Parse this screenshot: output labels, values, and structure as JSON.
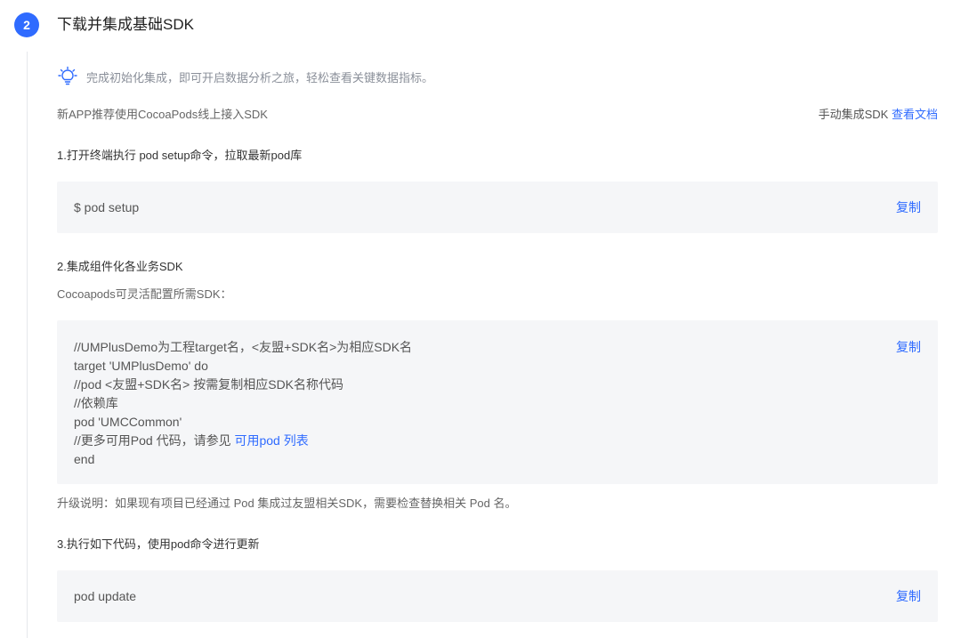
{
  "step": {
    "number": "2",
    "title": "下载并集成基础SDK"
  },
  "tip": {
    "icon": "lightbulb-icon",
    "text": "完成初始化集成，即可开启数据分析之旅，轻松查看关键数据指标。"
  },
  "intro": {
    "recommend_text": "新APP推荐使用CocoaPods线上接入SDK",
    "manual_label": "手动集成SDK",
    "docs_link": "查看文档"
  },
  "step1": {
    "heading": "1.打开终端执行 pod setup命令，拉取最新pod库",
    "code": "$ pod setup",
    "copy_label": "复制"
  },
  "step2": {
    "heading": "2.集成组件化各业务SDK",
    "description": "Cocoapods可灵活配置所需SDK：",
    "code_lines": {
      "line1": "//UMPlusDemo为工程target名，<友盟+SDK名>为相应SDK名",
      "line2": "target 'UMPlusDemo' do",
      "line3": "//pod <友盟+SDK名> 按需复制相应SDK名称代码",
      "line4": "//依赖库",
      "line5": "pod 'UMCCommon'",
      "line6_prefix": "//更多可用Pod 代码，请参见 ",
      "line6_link": "可用pod 列表",
      "line7": "end"
    },
    "copy_label": "复制",
    "upgrade_note": "升级说明：如果现有项目已经通过 Pod 集成过友盟相关SDK，需要检查替换相关 Pod 名。"
  },
  "step3": {
    "heading": "3.执行如下代码，使用pod命令进行更新",
    "code": "pod update",
    "copy_label": "复制"
  },
  "colors": {
    "accent": "#2f6bff",
    "code_background": "#f5f6f8"
  }
}
